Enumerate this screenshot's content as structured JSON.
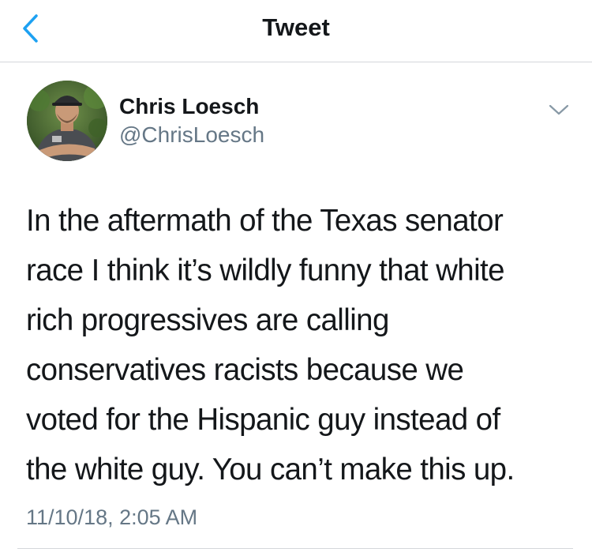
{
  "header": {
    "title": "Tweet",
    "back_icon": "chevron-left-icon",
    "accent_color": "#1da1f2"
  },
  "author": {
    "name": "Chris Loesch",
    "handle": "@ChrisLoesch",
    "avatar_icon": "profile-photo",
    "more_icon": "chevron-down-icon"
  },
  "tweet": {
    "lines": [
      "In the aftermath of the Texas senator",
      "race I think it’s wildly funny that white",
      "rich progressives are calling",
      "conservatives racists because we",
      "voted for the Hispanic guy instead of",
      "the white guy. You can’t make this up."
    ],
    "timestamp": "11/10/18, 2:05 AM"
  },
  "colors": {
    "text": "#14171a",
    "secondary_text": "#657786",
    "divider": "#d4d7da"
  }
}
